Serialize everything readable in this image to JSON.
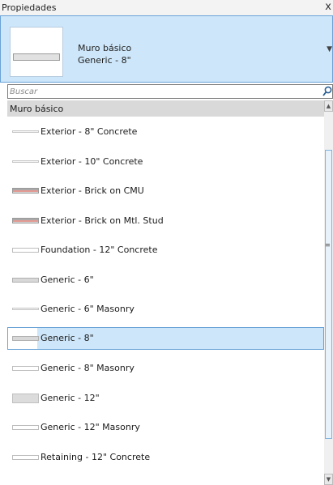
{
  "window": {
    "title": "Propiedades",
    "close_glyph": "x"
  },
  "current_type": {
    "family": "Muro básico",
    "name": "Generic - 8\"",
    "dropdown_glyph": "▼"
  },
  "search": {
    "placeholder": "Buscar",
    "value": ""
  },
  "group": {
    "label": "Muro básico"
  },
  "items": [
    {
      "label": "Exterior - 8\" Concrete",
      "swatch": "thin"
    },
    {
      "label": "Exterior - 10\" Concrete",
      "swatch": "thin"
    },
    {
      "label": "Exterior - Brick on CMU",
      "swatch": "brick"
    },
    {
      "label": "Exterior - Brick on Mtl. Stud",
      "swatch": "brick"
    },
    {
      "label": "Foundation - 12\" Concrete",
      "swatch": "plain"
    },
    {
      "label": "Generic - 6\"",
      "swatch": "gray"
    },
    {
      "label": "Generic - 6\" Masonry",
      "swatch": "thin"
    },
    {
      "label": "Generic - 8\"",
      "swatch": "gray",
      "selected": true
    },
    {
      "label": "Generic - 8\" Masonry",
      "swatch": "plain"
    },
    {
      "label": "Generic - 12\"",
      "swatch": "thick"
    },
    {
      "label": "Generic - 12\" Masonry",
      "swatch": "plain"
    },
    {
      "label": "Retaining - 12\" Concrete",
      "swatch": "plain"
    }
  ],
  "scrollbar": {
    "up_glyph": "▲",
    "down_glyph": "▼",
    "grip_glyph": "≡"
  },
  "icons": {
    "search": "search-icon",
    "close": "close-icon",
    "dropdown": "chevron-down-icon"
  }
}
